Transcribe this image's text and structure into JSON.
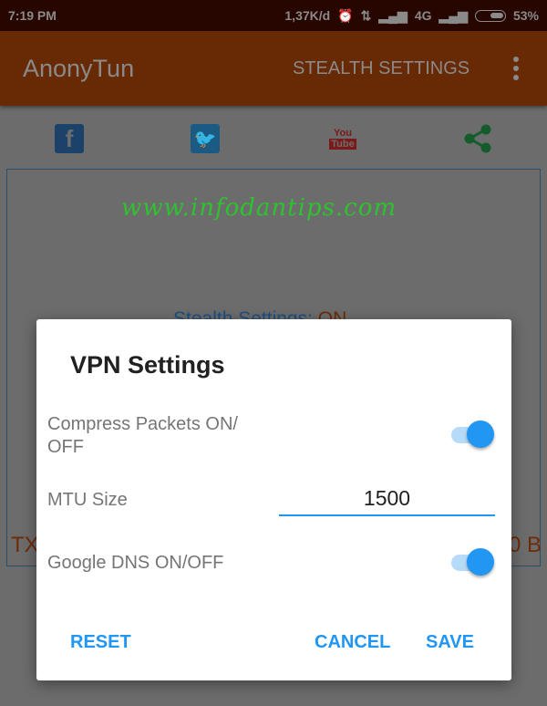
{
  "status_bar": {
    "time": "7:19 PM",
    "speed": "1,37K/d",
    "network": "4G",
    "battery": "53%"
  },
  "toolbar": {
    "title": "AnonyTun",
    "action": "STEALTH SETTINGS"
  },
  "social": {
    "facebook": "f",
    "youtube_top": "You",
    "youtube_bottom": "Tube"
  },
  "watermark": "www.infodantips.com",
  "main": {
    "stealth_label": "Stealth Settings:",
    "stealth_value": "ON",
    "tx_label": "TX",
    "rx_value_tail": "0 B"
  },
  "dialog": {
    "title": "VPN Settings",
    "compress_label": "Compress Packets ON/ OFF",
    "compress_on": true,
    "mtu_label": "MTU Size",
    "mtu_value": "1500",
    "dns_label": "Google DNS ON/OFF",
    "dns_on": true,
    "reset": "RESET",
    "cancel": "CANCEL",
    "save": "SAVE"
  },
  "colors": {
    "accent": "#2196f3",
    "toolbar": "#682a05"
  }
}
